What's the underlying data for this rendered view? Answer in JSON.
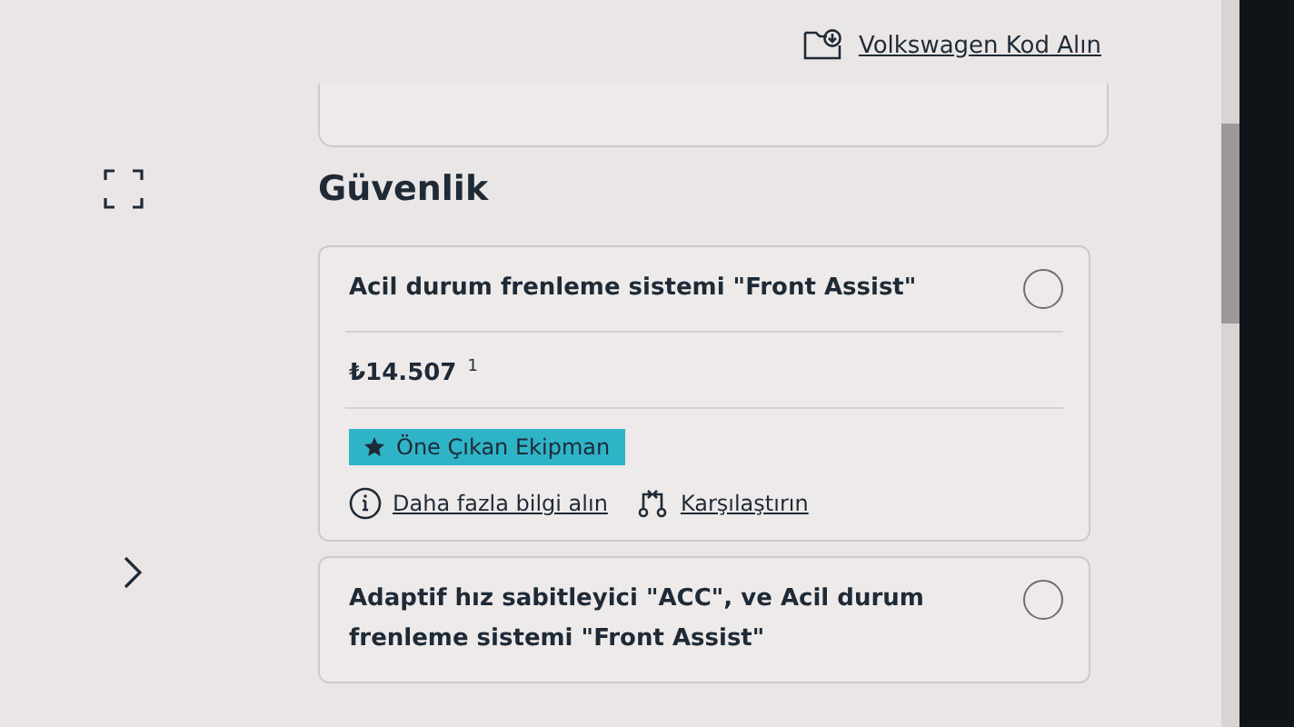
{
  "header_link": {
    "label": "Volkswagen Kod Alın"
  },
  "section": {
    "title": "Güvenlik"
  },
  "options": [
    {
      "title": "Acil durum frenleme sistemi \"Front Assist\"",
      "selected": false,
      "price": "₺14.507",
      "footnote": "1",
      "badge": "Öne Çıkan Ekipman",
      "links": [
        {
          "kind": "info",
          "label": "Daha fazla bilgi alın"
        },
        {
          "kind": "compare",
          "label": "Karşılaştırın"
        }
      ]
    },
    {
      "title": "Adaptif hız sabitleyici \"ACC\", ve Acil durum frenleme sistemi \"Front Assist\"",
      "selected": false
    }
  ]
}
